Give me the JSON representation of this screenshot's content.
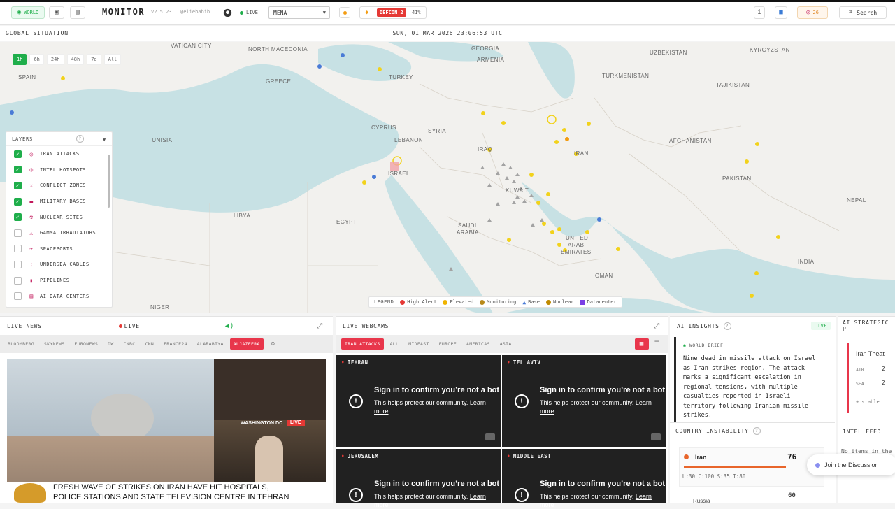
{
  "topbar": {
    "world_label": "WORLD",
    "brand": "MONITOR",
    "version": "v2.5.23",
    "user": "@eliehabib",
    "live_label": "LIVE",
    "region": "MENA",
    "defcon": "DEFCON 2",
    "defcon_pct": "41%",
    "notif_count": "26",
    "search_label": "Search"
  },
  "subbar": {
    "left": "GLOBAL SITUATION",
    "datetime": "SUN, 01 MAR 2026 23:06:53 UTC"
  },
  "time_filters": [
    "1h",
    "6h",
    "24h",
    "48h",
    "7d",
    "All"
  ],
  "map_labels": [
    {
      "text": "VATICAN CITY"
    },
    {
      "text": "NORTH MACEDONIA"
    },
    {
      "text": "GEORGIA"
    },
    {
      "text": "ARMENIA"
    },
    {
      "text": "UZBEKISTAN"
    },
    {
      "text": "KYRGYZSTAN"
    },
    {
      "text": "SPAIN"
    },
    {
      "text": "TURKEY"
    },
    {
      "text": "GREECE"
    },
    {
      "text": "TURKMENISTAN"
    },
    {
      "text": "TAJIKISTAN"
    },
    {
      "text": "TUNISIA"
    },
    {
      "text": "CYPRUS"
    },
    {
      "text": "SYRIA"
    },
    {
      "text": "LEBANON"
    },
    {
      "text": "IRAQ"
    },
    {
      "text": "IRAN"
    },
    {
      "text": "AFGHANISTAN"
    },
    {
      "text": "ISRAEL"
    },
    {
      "text": "PAKISTAN"
    },
    {
      "text": "NEPAL"
    },
    {
      "text": "LIBYA"
    },
    {
      "text": "EGYPT"
    },
    {
      "text": "KUWAIT"
    },
    {
      "text": "SAUDI"
    },
    {
      "text": "ARABIA"
    },
    {
      "text": "UNITED"
    },
    {
      "text": "ARAB"
    },
    {
      "text": "EMIRATES"
    },
    {
      "text": "INDIA"
    },
    {
      "text": "OMAN"
    },
    {
      "text": "NIGER"
    }
  ],
  "layers": {
    "title": "LAYERS",
    "items": [
      {
        "label": "IRAN ATTACKS",
        "checked": true,
        "icon": "target-icon"
      },
      {
        "label": "INTEL HOTSPOTS",
        "checked": true,
        "icon": "target-icon"
      },
      {
        "label": "CONFLICT ZONES",
        "checked": true,
        "icon": "swords-icon"
      },
      {
        "label": "MILITARY BASES",
        "checked": true,
        "icon": "tank-icon"
      },
      {
        "label": "NUCLEAR SITES",
        "checked": true,
        "icon": "radiation-icon"
      },
      {
        "label": "GAMMA IRRADIATORS",
        "checked": false,
        "icon": "warning-icon"
      },
      {
        "label": "SPACEPORTS",
        "checked": false,
        "icon": "rocket-icon"
      },
      {
        "label": "UNDERSEA CABLES",
        "checked": false,
        "icon": "cable-icon"
      },
      {
        "label": "PIPELINES",
        "checked": false,
        "icon": "pipeline-icon"
      },
      {
        "label": "AI DATA CENTERS",
        "checked": false,
        "icon": "server-icon"
      }
    ]
  },
  "legend": {
    "title": "LEGEND",
    "items": [
      {
        "label": "High Alert",
        "color": "#e53935"
      },
      {
        "label": "Elevated",
        "color": "#f0b400"
      },
      {
        "label": "Monitoring",
        "color": "#b88a1a"
      },
      {
        "label": "Base",
        "color": "#4a7bd6"
      },
      {
        "label": "Nuclear",
        "color": "#c08a00"
      },
      {
        "label": "Datacenter",
        "color": "#7b3fe4"
      }
    ]
  },
  "live_news": {
    "title": "LIVE NEWS",
    "live": "LIVE",
    "channels": [
      "BLOOMBERG",
      "SKYNEWS",
      "EURONEWS",
      "DW",
      "CNBC",
      "CNN",
      "FRANCE24",
      "ALARABIYA",
      "ALJAZEERA"
    ],
    "inset_label": "WASHINGTON DC",
    "inset_live": "LIVE",
    "ticker_line1": "FRESH WAVE OF STRIKES ON IRAN HAVE HIT HOSPITALS,",
    "ticker_line2": "POLICE STATIONS AND STATE TELEVISION CENTRE IN TEHRAN"
  },
  "webcams": {
    "title": "LIVE WEBCAMS",
    "tabs": [
      "IRAN ATTACKS",
      "ALL",
      "MIDEAST",
      "EUROPE",
      "AMERICAS",
      "ASIA"
    ],
    "cams": [
      {
        "label": "TEHRAN"
      },
      {
        "label": "TEL AVIV"
      },
      {
        "label": "JERUSALEM"
      },
      {
        "label": "MIDDLE EAST"
      }
    ],
    "msg": "Sign in to confirm you’re not a bot",
    "sub": "This helps protect our community.",
    "learn": "Learn more"
  },
  "ai_insights": {
    "title": "AI INSIGHTS",
    "badge": "LIVE",
    "tag": "WORLD BRIEF",
    "text": "Nine dead in missile attack on Israel as Iran strikes region. The attack marks a significant escalation in regional tensions, with multiple casualties reported in Israeli territory following Iranian missile strikes."
  },
  "strategic": {
    "title": "AI STRATEGIC P",
    "card_title": "Iran Theat",
    "air": "AIR",
    "sea": "SEA",
    "air_val": "2",
    "sea_val": "2",
    "stable": "+ stable"
  },
  "country_instability": {
    "title": "COUNTRY INSTABILITY",
    "country": "Iran",
    "score": "76",
    "stats": "U:30 C:100 S:35 I:80",
    "next_country": "Russia",
    "next_score": "60"
  },
  "intel_feed": {
    "title": "INTEL FEED",
    "empty": "No items in the"
  },
  "join": "Join the Discussion"
}
